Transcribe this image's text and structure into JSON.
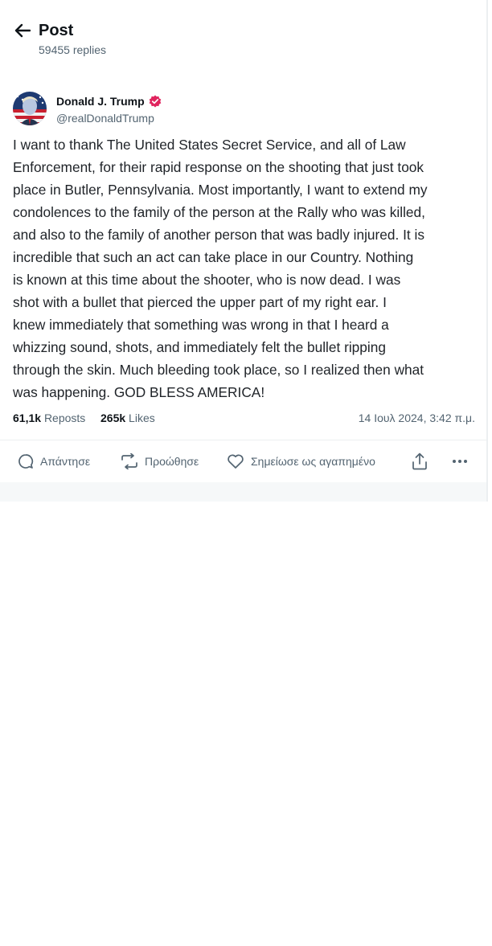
{
  "header": {
    "title": "Post",
    "reply_count": "59455 replies",
    "back_icon": "arrow-left-icon"
  },
  "author": {
    "name": "Donald J. Trump",
    "handle": "@realDonaldTrump",
    "verified_icon": "verified-badge-icon",
    "verified_color": "#e0245e"
  },
  "post": {
    "text": "I want to thank The United States Secret Service, and all of Law\nEnforcement, for their rapid response on the shooting that just took\nplace in Butler, Pennsylvania. Most importantly, I want to extend my\ncondolences to the family of the person at the Rally who was killed,\nand also to the family of another person that was badly injured. It is\nincredible that such an act can take place in our Country. Nothing\nis known at this time about the shooter, who is now dead. I was\nshot with a bullet that pierced the upper part of my right ear. I\nknew immediately that something was wrong in that I heard a\nwhizzing sound, shots, and immediately felt the bullet ripping\nthrough the skin. Much bleeding took place, so I realized then what\nwas happening. GOD BLESS AMERICA!"
  },
  "stats": {
    "reposts_count": "61,1k",
    "reposts_label": "Reposts",
    "likes_count": "265k",
    "likes_label": "Likes",
    "timestamp": "14 Ιουλ 2024, 3:42 π.μ."
  },
  "actions": {
    "reply_label": "Απάντησε",
    "reply_icon": "comment-icon",
    "repost_label": "Προώθησε",
    "repost_icon": "repost-icon",
    "like_label": "Σημείωσε ως αγαπημένο",
    "like_icon": "heart-icon",
    "share_icon": "share-icon",
    "more_icon": "more-dots-icon"
  },
  "colors": {
    "text_primary": "#0f1419",
    "text_secondary": "#536471",
    "divider": "#eceff1"
  }
}
